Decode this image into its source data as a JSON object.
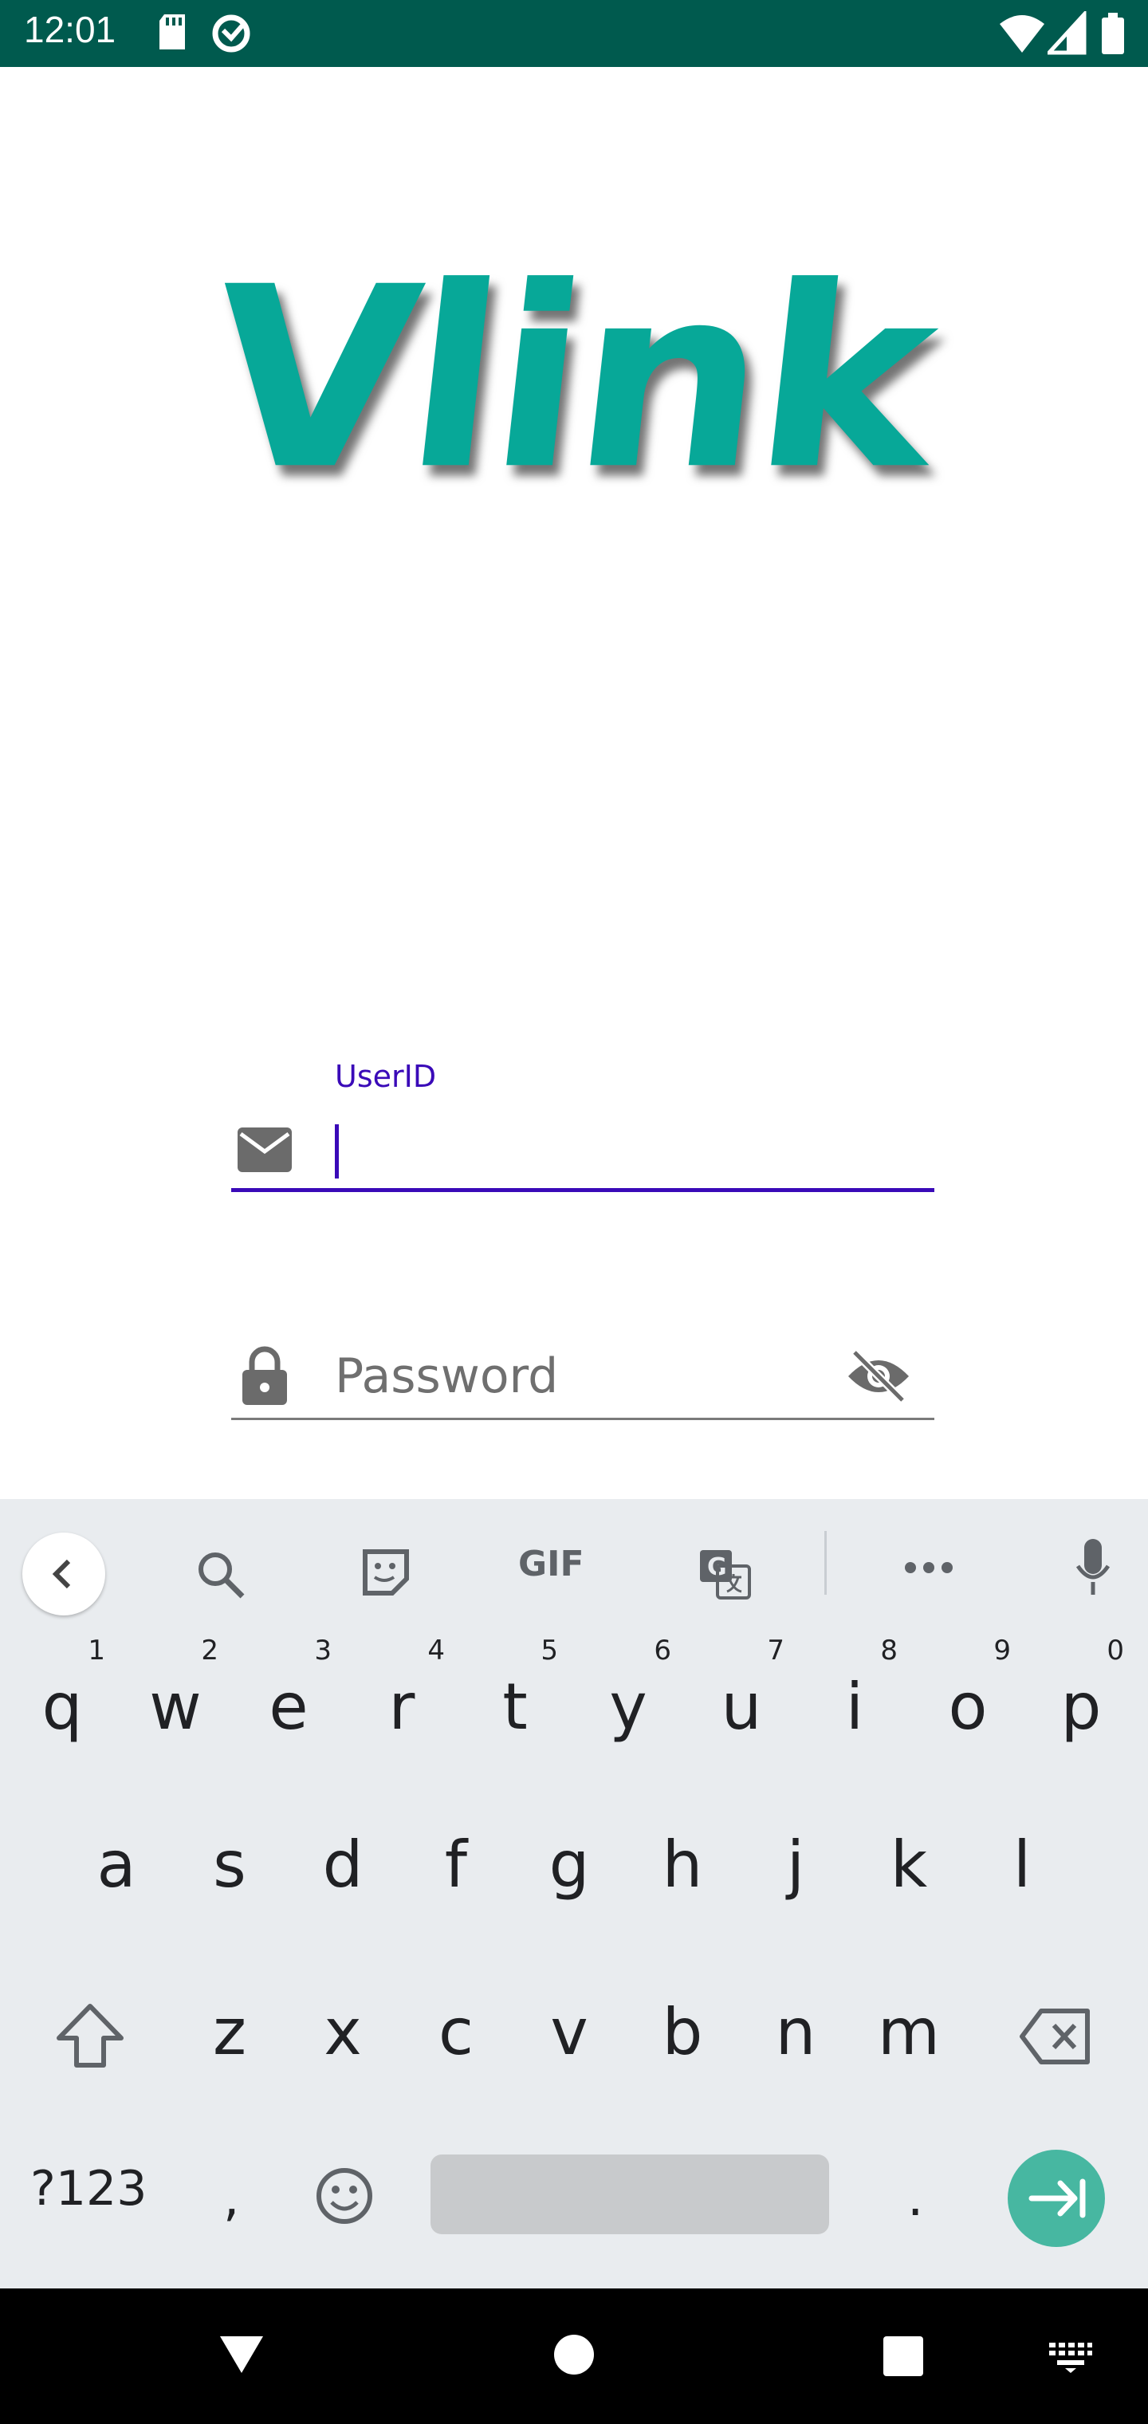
{
  "status_bar": {
    "time": "12:01",
    "left_icons": [
      "sd-card-icon",
      "data-saver-icon"
    ],
    "right_icons": [
      "wifi-icon",
      "signal-icon",
      "battery-icon"
    ]
  },
  "logo": {
    "text": "Vlink",
    "color": "#07a898"
  },
  "login_form": {
    "userid": {
      "label": "UserID",
      "value": "",
      "icon": "mail-icon"
    },
    "password": {
      "placeholder": "Password",
      "icon": "lock-icon",
      "toggle_icon": "eye-off-icon"
    },
    "accent": "#3a0ab8"
  },
  "keyboard": {
    "toolbar_icons": [
      "back-chevron-icon",
      "search-icon",
      "sticker-icon",
      "gif-icon",
      "translate-icon",
      "more-icon",
      "mic-icon"
    ],
    "gif_label": "GIF",
    "row1": [
      {
        "key": "q",
        "hint": "1"
      },
      {
        "key": "w",
        "hint": "2"
      },
      {
        "key": "e",
        "hint": "3"
      },
      {
        "key": "r",
        "hint": "4"
      },
      {
        "key": "t",
        "hint": "5"
      },
      {
        "key": "y",
        "hint": "6"
      },
      {
        "key": "u",
        "hint": "7"
      },
      {
        "key": "i",
        "hint": "8"
      },
      {
        "key": "o",
        "hint": "9"
      },
      {
        "key": "p",
        "hint": "0"
      }
    ],
    "row2": [
      "a",
      "s",
      "d",
      "f",
      "g",
      "h",
      "j",
      "k",
      "l"
    ],
    "row3": [
      "z",
      "x",
      "c",
      "v",
      "b",
      "n",
      "m"
    ],
    "bottom": {
      "mode": "?123",
      "comma": ",",
      "period": "."
    },
    "enter_color": "#47b7a1"
  },
  "nav_bar": {
    "icons": [
      "back-triangle-icon",
      "home-circle-icon",
      "recents-square-icon",
      "keyboard-switch-icon"
    ]
  }
}
